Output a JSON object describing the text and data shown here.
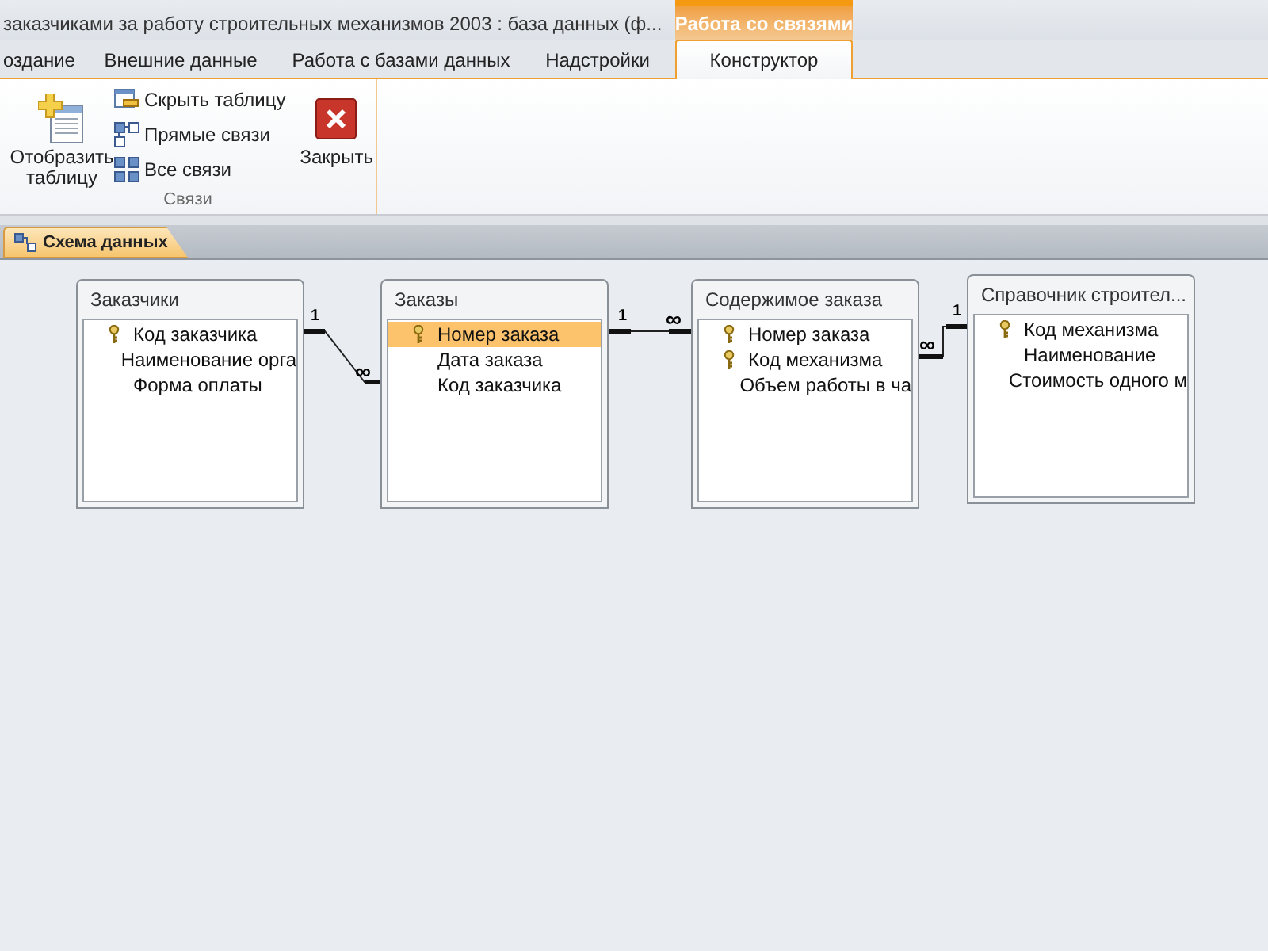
{
  "window": {
    "title": "заказчиками за работу строительных механизмов 2003 : база данных (ф..."
  },
  "context_tab_group": {
    "label": "Работа со связями"
  },
  "tabs": [
    {
      "label": "оздание",
      "selected": false
    },
    {
      "label": "Внешние данные",
      "selected": false
    },
    {
      "label": "Работа с базами данных",
      "selected": false
    },
    {
      "label": "Надстройки",
      "selected": false
    },
    {
      "label": "Конструктор",
      "selected": true
    }
  ],
  "ribbon": {
    "group": {
      "label": "Связи",
      "buttons": [
        {
          "kind": "large",
          "label": "Отобразить таблицу"
        },
        {
          "kind": "small",
          "label": "Скрыть таблицу"
        },
        {
          "kind": "small",
          "label": "Прямые связи"
        },
        {
          "kind": "small",
          "label": "Все связи"
        },
        {
          "kind": "large",
          "label": "Закрыть"
        }
      ]
    }
  },
  "document_tab": {
    "label": "Схема данных"
  },
  "tables": [
    {
      "title": "Заказчики",
      "fields": [
        {
          "name": "Код заказчика",
          "key": true,
          "selected": false
        },
        {
          "name": "Наименование орга",
          "key": false,
          "selected": false
        },
        {
          "name": "Форма оплаты",
          "key": false,
          "selected": false
        }
      ]
    },
    {
      "title": "Заказы",
      "fields": [
        {
          "name": "Номер заказа",
          "key": true,
          "selected": true
        },
        {
          "name": "Дата заказа",
          "key": false,
          "selected": false
        },
        {
          "name": "Код заказчика",
          "key": false,
          "selected": false
        }
      ]
    },
    {
      "title": "Содержимое заказа",
      "fields": [
        {
          "name": "Номер заказа",
          "key": true,
          "selected": false
        },
        {
          "name": "Код механизма",
          "key": true,
          "selected": false
        },
        {
          "name": "Объем работы в ча",
          "key": false,
          "selected": false
        }
      ]
    },
    {
      "title": "Справочник строител...",
      "fields": [
        {
          "name": "Код механизма",
          "key": true,
          "selected": false
        },
        {
          "name": "Наименование",
          "key": false,
          "selected": false
        },
        {
          "name": "Стоимость одного м",
          "key": false,
          "selected": false
        }
      ]
    }
  ],
  "relationships": [
    {
      "one_label": "1",
      "many_label": "∞"
    },
    {
      "one_label": "1",
      "many_label": "∞"
    },
    {
      "one_label": "1",
      "many_label": "∞"
    }
  ]
}
